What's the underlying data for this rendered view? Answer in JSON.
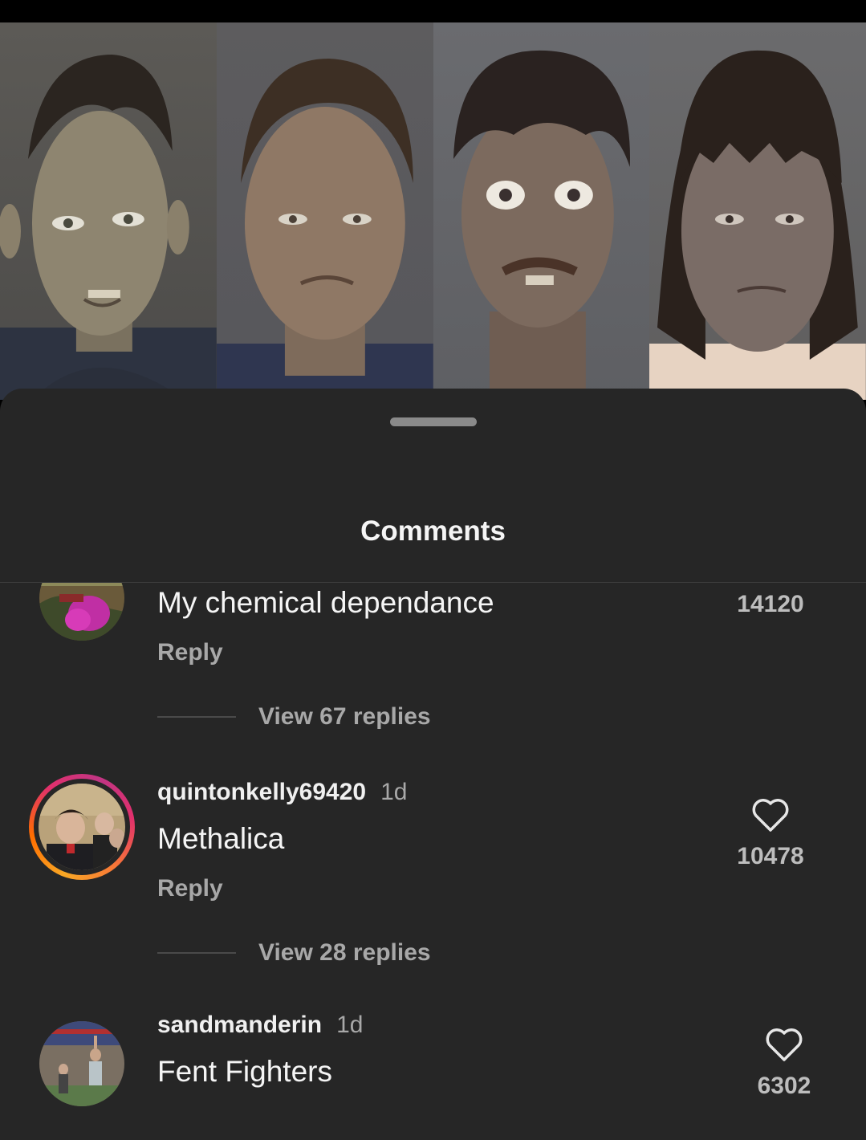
{
  "sheet": {
    "title": "Comments"
  },
  "comments": [
    {
      "username": "",
      "time": "",
      "text": "My chemical dependance",
      "reply_label": "Reply",
      "view_replies": "View 67 replies",
      "likes": "14120",
      "has_story_ring": false
    },
    {
      "username": "quintonkelly69420",
      "time": "1d",
      "text": "Methalica",
      "reply_label": "Reply",
      "view_replies": "View 28 replies",
      "likes": "10478",
      "has_story_ring": true
    },
    {
      "username": "sandmanderin",
      "time": "1d",
      "text": "Fent Fighters",
      "likes": "6302",
      "has_story_ring": false
    }
  ],
  "icons": {
    "like": "heart-icon",
    "sheet_handle": "drag-handle"
  },
  "colors": {
    "sheet_background": "#262626",
    "secondary_text": "#a8a8a8",
    "story_ring": [
      "#f9a825",
      "#e1306c",
      "#c13584"
    ]
  }
}
